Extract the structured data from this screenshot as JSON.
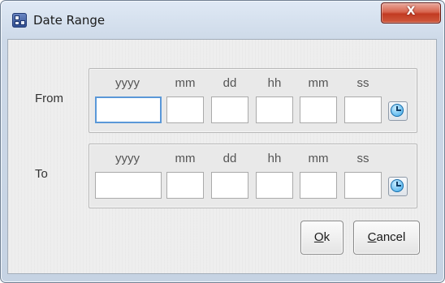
{
  "window": {
    "title": "Date Range",
    "close_glyph": "X"
  },
  "icons": {
    "app": "app-window-icon",
    "close": "close-icon",
    "clock": "clock-icon"
  },
  "columns": [
    "yyyy",
    "mm",
    "dd",
    "hh",
    "mm",
    "ss"
  ],
  "from": {
    "label": "From",
    "values": {
      "year": "",
      "month": "",
      "day": "",
      "hour": "",
      "minute": "",
      "second": ""
    },
    "focused_field": "year"
  },
  "to": {
    "label": "To",
    "values": {
      "year": "",
      "month": "",
      "day": "",
      "hour": "",
      "minute": "",
      "second": ""
    }
  },
  "buttons": {
    "ok": {
      "mnemonic": "O",
      "rest": "k"
    },
    "cancel": {
      "mnemonic": "C",
      "rest": "ancel"
    }
  },
  "colors": {
    "close_button": "#c9452d",
    "focus_border": "#5a98d8",
    "clock_face": "#5ab7ee"
  }
}
